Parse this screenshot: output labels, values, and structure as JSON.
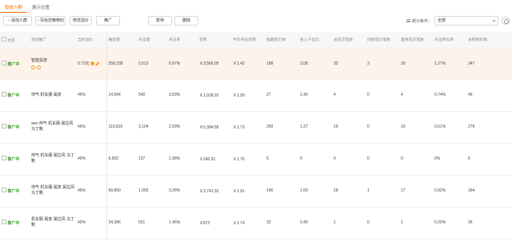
{
  "tabs": [
    {
      "label": "投放人群"
    },
    {
      "label": "展示位置"
    }
  ],
  "toolbar": {
    "add_crowd": "添加人群",
    "add_crowd_plus": "+",
    "add_similar": "写给您推荐的",
    "add_similar_plus": "+",
    "modify_bid": "修改溢价",
    "promote": "推广",
    "pause": "暂停",
    "delete": "删除",
    "condition_label": "统计条件：",
    "condition_value": "全部"
  },
  "table": {
    "headers": [
      "状态",
      "定向推广",
      "当前溢价",
      "展现量",
      "点击量",
      "点击率",
      "花费",
      "平均点击花费",
      "收藏宝贝数",
      "投入产出比",
      "总成交笔数",
      "间接成交笔数",
      "直接成交笔数",
      "点击转化率",
      "总购物车数"
    ],
    "rows": [
      {
        "status": "推广中",
        "plan": "智能投放",
        "bid": "0.72元",
        "impressions": "258,238",
        "clicks": "2,513",
        "ctr": "0.97%",
        "cost": "￥3,566.05",
        "cpc": "￥1.42",
        "fav": "198",
        "roi": "3.08",
        "total_orders": "32",
        "indirect": "3",
        "direct": "29",
        "cvr": "1.27%",
        "cart": "247"
      },
      {
        "status": "推广中",
        "plan": "帅气 机车服 属皮",
        "bid": "45%",
        "impressions": "14,094",
        "clicks": "540",
        "ctr": "3.83%",
        "cost": "￥1,028.20",
        "cpc": "￥1.90",
        "fav": "27",
        "roi": "1.40",
        "total_orders": "4",
        "indirect": "0",
        "direct": "4",
        "cvr": "0.74%",
        "cart": "46"
      },
      {
        "status": "推广中",
        "plan": "ann 帅气 机车服 属拉风 马丁靴",
        "bid": "45%",
        "impressions": "119,819",
        "clicks": "3,104",
        "ctr": "2.59%",
        "cost": "￥5,384.58",
        "cpc": "￥1.73",
        "fav": "269",
        "roi": "1.27",
        "total_orders": "19",
        "indirect": "0",
        "direct": "19",
        "cvr": "0.61%",
        "cart": "279"
      },
      {
        "status": "推广中",
        "plan": "帅气 机车服 属拉风 马丁靴",
        "bid": "40%",
        "impressions": "6,902",
        "clicks": "137",
        "ctr": "1.98%",
        "cost": "￥240.91",
        "cpc": "￥1.76",
        "fav": "5",
        "roi": "0",
        "total_orders": "0",
        "indirect": "0",
        "direct": "0",
        "cvr": "0%",
        "cart": "6"
      },
      {
        "status": "推广中",
        "plan": "帅气 机车服 属皮 属拉风 马丁靴",
        "bid": "45%",
        "impressions": "59,650",
        "clicks": "1,955",
        "ctr": "3.28%",
        "cost": "￥3,741.32",
        "cpc": "￥1.91",
        "fav": "146",
        "roi": "1.69",
        "total_orders": "18",
        "indirect": "1",
        "direct": "17",
        "cvr": "0.92%",
        "cart": "184"
      },
      {
        "status": "推广中",
        "plan": "机车服 属皮 属拉风 马丁靴",
        "bid": "40%",
        "impressions": "34,286",
        "clicks": "501",
        "ctr": "1.46%",
        "cost": "￥872",
        "cpc": "￥1.74",
        "fav": "33",
        "roi": "0.40",
        "total_orders": "1",
        "indirect": "0",
        "direct": "1",
        "cvr": "0.20%",
        "cart": "36"
      }
    ]
  },
  "colors": {
    "accent": "#ff6a00",
    "status_green": "#3a9a2a",
    "highlight_row": "#fdf3ea"
  }
}
